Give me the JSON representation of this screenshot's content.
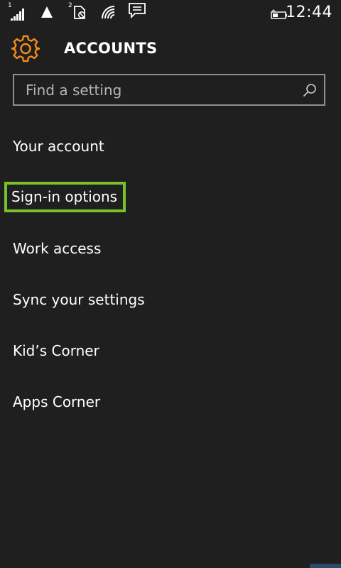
{
  "status_bar": {
    "sim1_label": "1",
    "sim2_label": "2",
    "time": "12:44",
    "icons": [
      "signal-bars-icon",
      "triangle-signal-icon",
      "no-sim-icon",
      "wifi-icon",
      "notification-icon",
      "battery-icon"
    ]
  },
  "header": {
    "title": "ACCOUNTS",
    "icon": "gear-icon",
    "accent_color": "#f28c1a"
  },
  "search": {
    "placeholder": "Find a setting",
    "value": ""
  },
  "menu": {
    "items": [
      {
        "label": "Your account"
      },
      {
        "label": "Sign-in options",
        "highlighted": true
      },
      {
        "label": "Work access"
      },
      {
        "label": "Sync your settings"
      },
      {
        "label": "Kid’s Corner"
      },
      {
        "label": "Apps Corner"
      }
    ],
    "highlight_color": "#7ac02a"
  }
}
